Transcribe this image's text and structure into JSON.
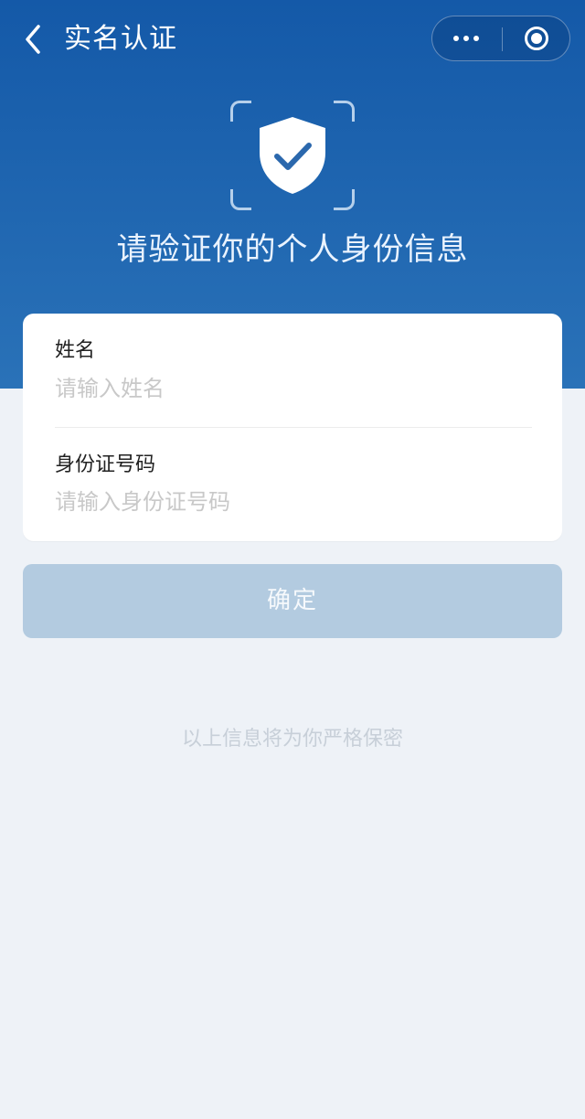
{
  "header": {
    "title": "实名认证",
    "back_icon": "chevron-left-icon",
    "more_icon": "more-dots-icon",
    "close_icon": "target-circle-icon"
  },
  "hero": {
    "icon": "shield-check-icon",
    "title": "请验证你的个人身份信息"
  },
  "form": {
    "name_label": "姓名",
    "name_placeholder": "请输入姓名",
    "id_label": "身份证号码",
    "id_placeholder": "请输入身份证号码"
  },
  "actions": {
    "confirm_label": "确定"
  },
  "footer": {
    "privacy_note": "以上信息将为你严格保密"
  },
  "colors": {
    "header_top": "#1459a8",
    "header_bottom": "#2a72b8",
    "page_background": "#eef2f7",
    "button_disabled": "#b3cbe0"
  }
}
